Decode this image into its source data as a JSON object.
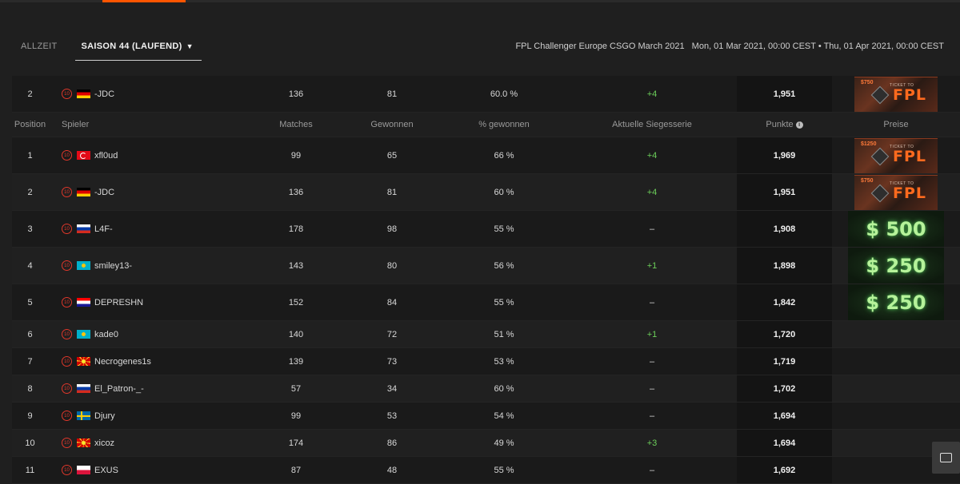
{
  "tabs": [
    {
      "label": "ALLZEIT"
    },
    {
      "label": "SAISON 44 (LAUFEND)",
      "icon": "chevron-down-icon"
    }
  ],
  "season": {
    "name": "FPL Challenger Europe CSGO March 2021",
    "start": "Mon, 01 Mar 2021, 00:00 CEST",
    "separator": "•",
    "end": "Thu, 01 Apr 2021, 00:00 CEST"
  },
  "highlight_row": {
    "position": "2",
    "flag": "de",
    "player": "-JDC",
    "matches": "136",
    "wins": "81",
    "pct": "60.0 %",
    "streak": "+4",
    "points": "1,951",
    "prize": {
      "type": "ticket",
      "amount": "$750",
      "label": "TICKET TO",
      "brand": "FPL"
    }
  },
  "columns": {
    "position": "Position",
    "player": "Spieler",
    "matches": "Matches",
    "wins": "Gewonnen",
    "pct": "% gewonnen",
    "streak": "Aktuelle Siegesserie",
    "points": "Punkte",
    "prize": "Preise"
  },
  "rows": [
    {
      "position": "1",
      "flag": "tr",
      "player": "xfl0ud",
      "matches": "99",
      "wins": "65",
      "pct": "66 %",
      "streak": "+4",
      "points": "1,969",
      "prize": {
        "type": "ticket",
        "amount": "$1250",
        "label": "TICKET TO",
        "brand": "FPL"
      }
    },
    {
      "position": "2",
      "flag": "de",
      "player": "-JDC",
      "matches": "136",
      "wins": "81",
      "pct": "60 %",
      "streak": "+4",
      "points": "1,951",
      "prize": {
        "type": "ticket",
        "amount": "$750",
        "label": "TICKET TO",
        "brand": "FPL"
      }
    },
    {
      "position": "3",
      "flag": "ru",
      "player": "L4F-",
      "matches": "178",
      "wins": "98",
      "pct": "55 %",
      "streak": "–",
      "points": "1,908",
      "prize": {
        "type": "cash",
        "label": "$ 500"
      }
    },
    {
      "position": "4",
      "flag": "kz",
      "player": "smiley13-",
      "matches": "143",
      "wins": "80",
      "pct": "56 %",
      "streak": "+1",
      "points": "1,898",
      "prize": {
        "type": "cash",
        "label": "$ 250"
      }
    },
    {
      "position": "5",
      "flag": "hr",
      "player": "DEPRESHN",
      "matches": "152",
      "wins": "84",
      "pct": "55 %",
      "streak": "–",
      "points": "1,842",
      "prize": {
        "type": "cash",
        "label": "$ 250"
      }
    },
    {
      "position": "6",
      "flag": "kz",
      "player": "kade0",
      "matches": "140",
      "wins": "72",
      "pct": "51 %",
      "streak": "+1",
      "points": "1,720",
      "prize": null
    },
    {
      "position": "7",
      "flag": "mk",
      "player": "Necrogenes1s",
      "matches": "139",
      "wins": "73",
      "pct": "53 %",
      "streak": "–",
      "points": "1,719",
      "prize": null
    },
    {
      "position": "8",
      "flag": "ru",
      "player": "El_Patron-_-",
      "matches": "57",
      "wins": "34",
      "pct": "60 %",
      "streak": "–",
      "points": "1,702",
      "prize": null
    },
    {
      "position": "9",
      "flag": "se",
      "player": "Djury",
      "matches": "99",
      "wins": "53",
      "pct": "54 %",
      "streak": "–",
      "points": "1,694",
      "prize": null
    },
    {
      "position": "10",
      "flag": "mk",
      "player": "xicoz",
      "matches": "174",
      "wins": "86",
      "pct": "49 %",
      "streak": "+3",
      "points": "1,694",
      "prize": null
    },
    {
      "position": "11",
      "flag": "pl",
      "player": "EXUS",
      "matches": "87",
      "wins": "48",
      "pct": "55 %",
      "streak": "–",
      "points": "1,692",
      "prize": null
    }
  ],
  "colors": {
    "accent": "#ff5500",
    "streak_positive": "#6ccf5a",
    "level_badge": "#e0372a"
  },
  "level_icon": "level-10-icon",
  "level_label": "10",
  "info_icon_label": "i",
  "chat_icon": "chat-icon"
}
